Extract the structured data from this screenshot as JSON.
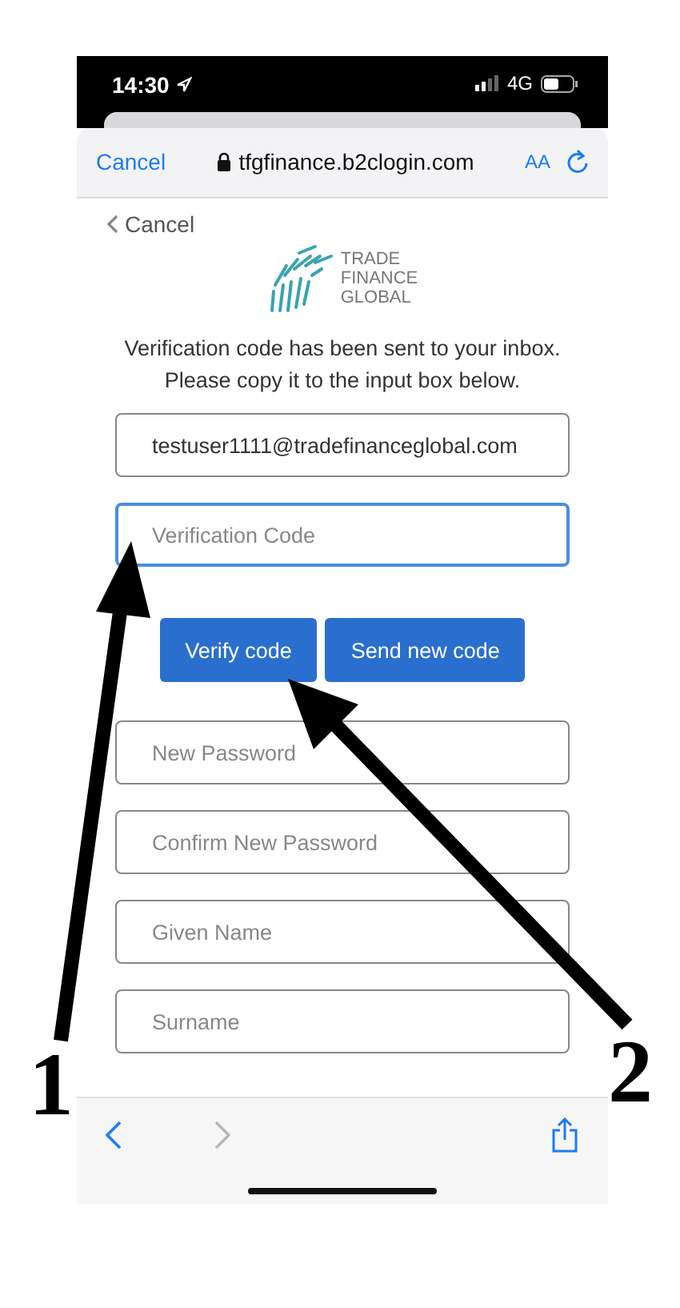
{
  "status_bar": {
    "time": "14:30",
    "network": "4G"
  },
  "browser_bar": {
    "cancel": "Cancel",
    "aa": "AA",
    "url": "tfgfinance.b2clogin.com"
  },
  "page": {
    "back_link": "Cancel",
    "logo": [
      "TRADE",
      "FINANCE",
      "GLOBAL"
    ],
    "message": "Verification code has been sent to your inbox. Please copy it to the input box below.",
    "fields": [
      {
        "value": "testuser1111@tradefinanceglobal.com",
        "focused": false
      },
      {
        "placeholder": "Verification Code",
        "focused": true
      }
    ],
    "buttons": [
      "Verify code",
      "Send new code"
    ],
    "more_fields": [
      {
        "placeholder": "New Password",
        "focused": false
      },
      {
        "placeholder": "Confirm New Password",
        "focused": false
      },
      {
        "placeholder": "Given Name",
        "focused": false
      },
      {
        "placeholder": "Surname",
        "focused": false
      }
    ]
  },
  "toolbar": {
    "back_enabled": true,
    "forward_enabled": false
  },
  "annotations": [
    {
      "label": "1"
    },
    {
      "label": "2"
    }
  ]
}
